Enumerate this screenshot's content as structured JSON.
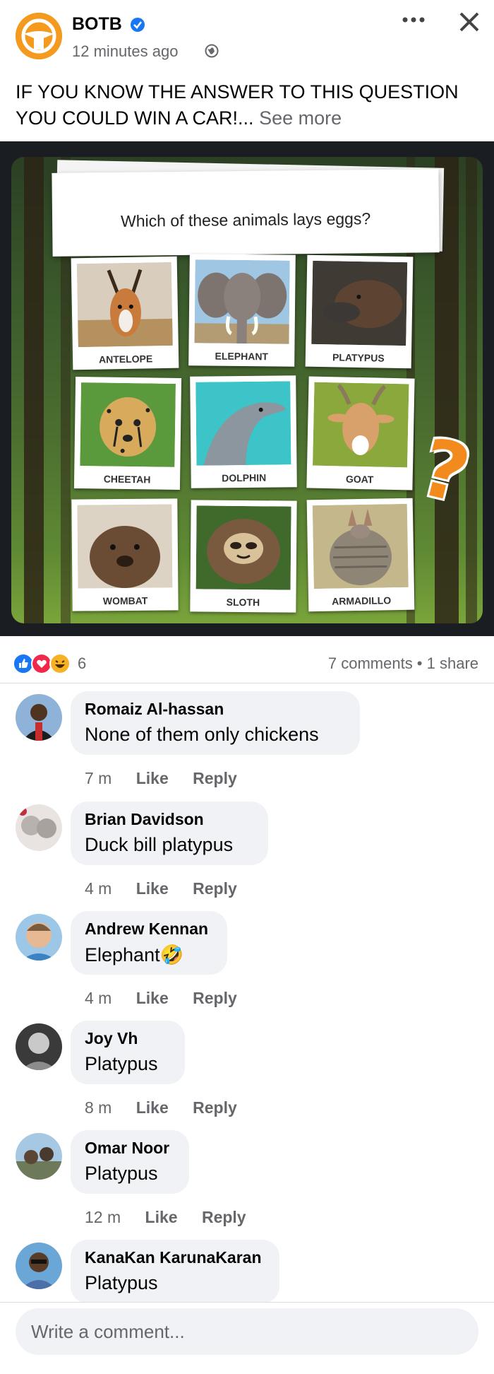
{
  "post": {
    "page_name": "BOTB",
    "time": "12 minutes ago",
    "text": "IF YOU KNOW THE ANSWER TO THIS QUESTION YOU COULD WIN A CAR!...",
    "see_more": "See more",
    "accent_color": "#f39a1f"
  },
  "image": {
    "question": "Which of these animals lays eggs?",
    "tiles": [
      "ANTELOPE",
      "ELEPHANT",
      "PLATYPUS",
      "CHEETAH",
      "DOLPHIN",
      "GOAT",
      "WOMBAT",
      "SLOTH",
      "ARMADILLO"
    ],
    "question_mark": "?"
  },
  "stats": {
    "reactions_count": "6",
    "comments_shares": "7 comments • 1 share",
    "reaction_icons": [
      "like-icon",
      "love-icon",
      "haha-icon"
    ]
  },
  "comments": [
    {
      "author": "Romaiz Al-hassan",
      "text": "None of them only chickens",
      "time": "7 m",
      "like": "Like",
      "reply": "Reply"
    },
    {
      "author": "Brian Davidson",
      "text": "Duck bill platypus",
      "time": "4 m",
      "like": "Like",
      "reply": "Reply"
    },
    {
      "author": "Andrew Kennan",
      "text": "Elephant🤣",
      "time": "4 m",
      "like": "Like",
      "reply": "Reply"
    },
    {
      "author": "Joy Vh",
      "text": "Platypus",
      "time": "8 m",
      "like": "Like",
      "reply": "Reply"
    },
    {
      "author": "Omar Noor",
      "text": "Platypus",
      "time": "12 m",
      "like": "Like",
      "reply": "Reply"
    },
    {
      "author": "KanaKan KarunaKaran",
      "text": "Platypus"
    }
  ],
  "composer": {
    "placeholder": "Write a comment..."
  }
}
